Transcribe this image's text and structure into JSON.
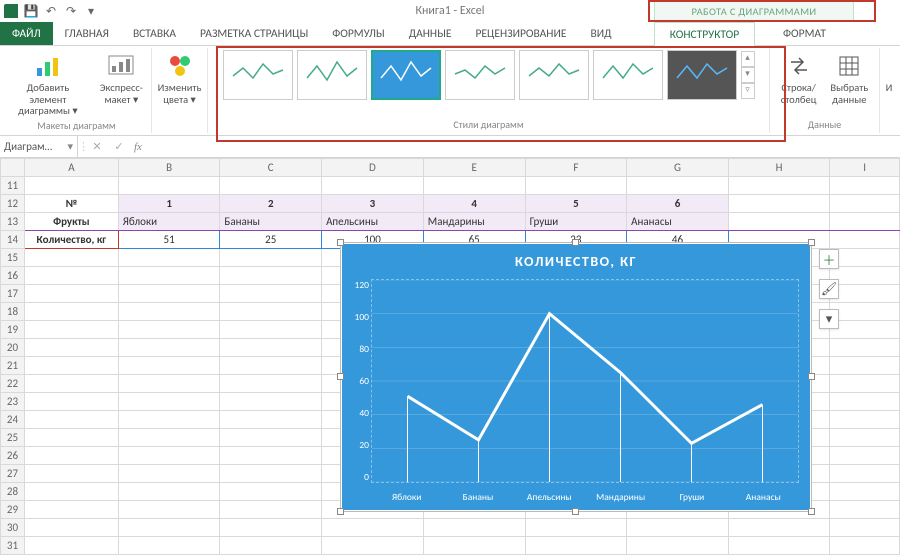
{
  "app_title": "Книга1 - Excel",
  "contextual_tab_title": "РАБОТА С ДИАГРАММАМИ",
  "tabs": {
    "file": "ФАЙЛ",
    "home": "ГЛАВНАЯ",
    "insert": "ВСТАВКА",
    "page_layout": "РАЗМЕТКА СТРАНИЦЫ",
    "formulas": "ФОРМУЛЫ",
    "data": "ДАННЫЕ",
    "review": "РЕЦЕНЗИРОВАНИЕ",
    "view": "ВИД",
    "design": "КОНСТРУКТОР",
    "format": "ФОРМАТ"
  },
  "ribbon": {
    "add_element": "Добавить элемент\nдиаграммы ▾",
    "quick_layout": "Экспресс-\nмакет ▾",
    "layouts_group": "Макеты диаграмм",
    "change_colors": "Изменить\nцвета ▾",
    "styles_group": "Стили диаграмм",
    "switch_rowcol": "Строка/\nстолбец",
    "select_data": "Выбрать\nданные",
    "data_group": "Данные"
  },
  "formula_bar": {
    "namebox": "Диаграм…",
    "fx": "fx"
  },
  "columns": [
    "A",
    "B",
    "C",
    "D",
    "E",
    "F",
    "G",
    "H",
    "I"
  ],
  "rows": [
    11,
    12,
    13,
    14,
    15,
    16,
    17,
    18,
    19,
    20,
    21,
    22,
    23,
    24,
    25,
    26,
    27,
    28,
    29,
    30,
    31
  ],
  "table": {
    "h1": "№",
    "h2": "Фрукты",
    "h3": "Количество, кг",
    "nums": [
      "1",
      "2",
      "3",
      "4",
      "5",
      "6"
    ],
    "fruits": [
      "Яблоки",
      "Бананы",
      "Апельсины",
      "Мандарины",
      "Груши",
      "Ананасы"
    ],
    "qty": [
      "51",
      "25",
      "100",
      "65",
      "23",
      "46"
    ]
  },
  "chart_data": {
    "type": "line",
    "title": "КОЛИЧЕСТВО, КГ",
    "categories": [
      "Яблоки",
      "Бананы",
      "Апельсины",
      "Мандарины",
      "Груши",
      "Ананасы"
    ],
    "values": [
      51,
      25,
      100,
      65,
      23,
      46
    ],
    "yticks": [
      0,
      20,
      40,
      60,
      80,
      100,
      120
    ],
    "ylim": [
      0,
      120
    ],
    "xlabel": "",
    "ylabel": ""
  }
}
